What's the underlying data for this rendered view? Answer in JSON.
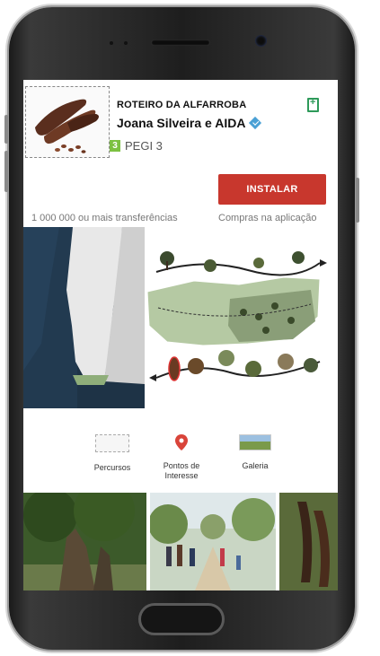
{
  "app": {
    "title": "ROTEIRO DA  ALFARROBA",
    "developer": "Joana Silveira e AIDA",
    "rating": "PEGI 3",
    "rating_badge": "3",
    "install_label": "INSTALAR",
    "downloads": "1 000 000 ou mais transferências",
    "in_app": "Compras na aplicação"
  },
  "nav": [
    {
      "label": "Percursos",
      "icon": "routes-map-icon"
    },
    {
      "label": "Pontos de Interesse",
      "icon": "location-pin-icon"
    },
    {
      "label": "Galeria",
      "icon": "gallery-photo-icon"
    }
  ],
  "colors": {
    "install": "#c8372d",
    "bookmark": "#2e9a5a",
    "pin": "#d9443a",
    "map_region": "#b5c9a3"
  }
}
